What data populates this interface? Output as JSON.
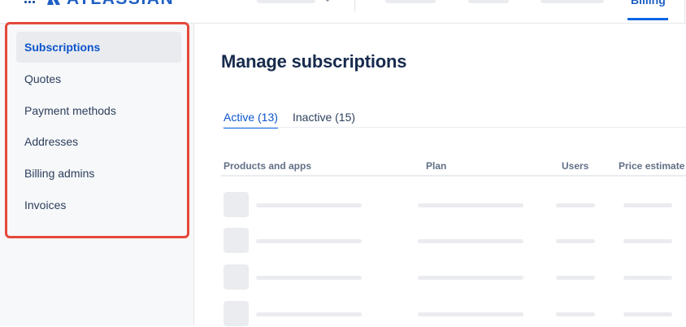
{
  "header": {
    "logo_text": "ATLASSIAN",
    "active_tab": "Billing",
    "brand_color": "#1f5fc5"
  },
  "sidebar": {
    "items": [
      {
        "label": "Subscriptions",
        "active": true
      },
      {
        "label": "Quotes"
      },
      {
        "label": "Payment methods"
      },
      {
        "label": "Addresses"
      },
      {
        "label": "Billing admins"
      },
      {
        "label": "Invoices"
      }
    ],
    "highlight_color": "#e5493a"
  },
  "main": {
    "title": "Manage subscriptions",
    "tabs": [
      {
        "label": "Active (13)",
        "active": true
      },
      {
        "label": "Inactive (15)"
      }
    ],
    "table": {
      "columns": [
        "Products and apps",
        "Plan",
        "Users",
        "Price estimate"
      ],
      "loading_rows": 4
    }
  }
}
